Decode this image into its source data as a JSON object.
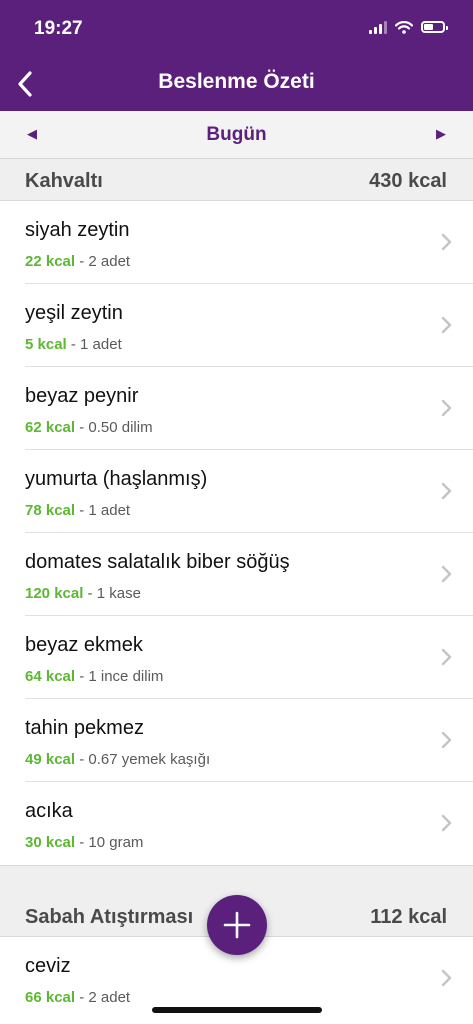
{
  "status": {
    "time": "19:27"
  },
  "nav": {
    "title": "Beslenme Özeti"
  },
  "date": {
    "label": "Bugün"
  },
  "sections": [
    {
      "name": "Kahvaltı",
      "kcal": "430 kcal",
      "items": [
        {
          "name": "siyah zeytin",
          "kcal": "22 kcal",
          "portion": " - 2 adet"
        },
        {
          "name": "yeşil zeytin",
          "kcal": "5 kcal",
          "portion": " - 1 adet"
        },
        {
          "name": "beyaz peynir",
          "kcal": "62 kcal",
          "portion": " - 0.50 dilim"
        },
        {
          "name": "yumurta (haşlanmış)",
          "kcal": "78 kcal",
          "portion": " - 1 adet"
        },
        {
          "name": "domates salatalık biber söğüş",
          "kcal": "120 kcal",
          "portion": " - 1 kase"
        },
        {
          "name": "beyaz ekmek",
          "kcal": "64 kcal",
          "portion": " - 1 ince dilim"
        },
        {
          "name": "tahin pekmez",
          "kcal": "49 kcal",
          "portion": " - 0.67 yemek kaşığı"
        },
        {
          "name": "acıka",
          "kcal": "30 kcal",
          "portion": " - 10 gram"
        }
      ]
    },
    {
      "name": "Sabah Atıştırması",
      "kcal": "112 kcal",
      "items": [
        {
          "name": "ceviz",
          "kcal": "66 kcal",
          "portion": " - 2 adet"
        }
      ]
    }
  ],
  "colors": {
    "brand": "#5b1f7c",
    "kcal_green": "#5cb833"
  },
  "icons": {
    "back": "chevron-left-icon",
    "prev": "triangle-left-icon",
    "next": "triangle-right-icon",
    "row": "chevron-right-icon",
    "add": "plus-icon"
  }
}
